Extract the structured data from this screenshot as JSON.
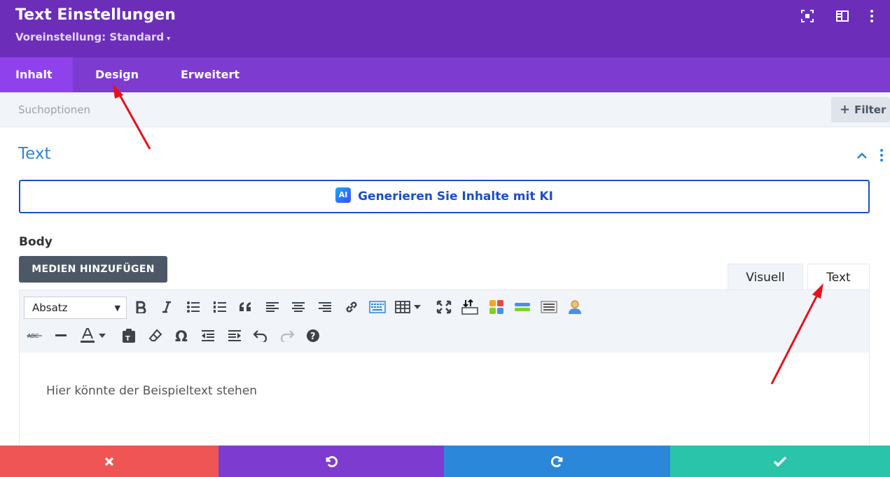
{
  "header": {
    "title": "Text Einstellungen",
    "preset": "Voreinstellung: Standard",
    "icons": [
      "focus-icon",
      "sidebar-layout-icon",
      "more-vertical-icon"
    ]
  },
  "tabs": [
    {
      "label": "Inhalt",
      "active": true
    },
    {
      "label": "Design",
      "active": false
    },
    {
      "label": "Erweitert",
      "active": false
    }
  ],
  "search": {
    "placeholder": "Suchoptionen",
    "filter_label": "Filter"
  },
  "section": {
    "title": "Text",
    "ai_badge": "AI",
    "ai_button": "Generieren Sie Inhalte mit KI",
    "body_label": "Body",
    "media_button": "MEDIEN HINZUFÜGEN",
    "mode_tabs": [
      "Visuell",
      "Text"
    ],
    "format_select": "Absatz",
    "editor_text": "Hier könnte der Beispieltext stehen"
  },
  "toolbar_row1": [
    "bold-icon",
    "italic-icon",
    "bullet-list-icon",
    "numbered-list-icon",
    "blockquote-icon",
    "align-left-icon",
    "align-center-icon",
    "align-right-icon",
    "link-icon",
    "keyboard-icon",
    "table-icon",
    "fullscreen-icon",
    "insert-icon",
    "colorful-grid-icon",
    "layers-icon",
    "list-box-icon",
    "user-icon"
  ],
  "toolbar_row2": [
    "strikethrough-icon",
    "horizontal-line-icon",
    "text-color-icon",
    "paste-text-icon",
    "eraser-icon",
    "omega-icon",
    "outdent-icon",
    "indent-icon",
    "undo-icon",
    "redo-icon",
    "help-icon"
  ],
  "footer": [
    "cancel-icon",
    "undo-icon",
    "redo-icon",
    "save-check-icon"
  ],
  "colors": {
    "header": "#6c2eb9",
    "tab_bar": "#7e3bd0",
    "tab_active": "#8f42ec",
    "link_blue": "#2b87da",
    "cancel": "#ef5555",
    "save": "#29c4a9",
    "annotation_arrow": "#e8101a"
  }
}
